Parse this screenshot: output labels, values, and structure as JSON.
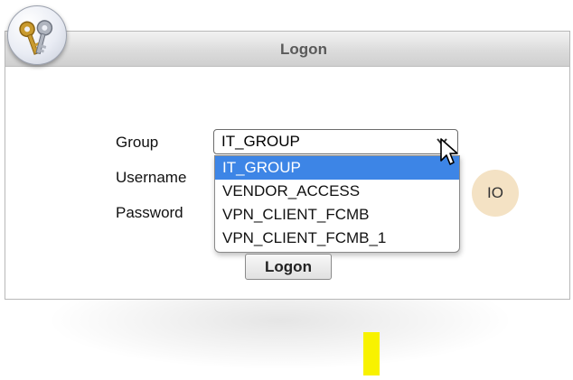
{
  "window": {
    "title": "Logon"
  },
  "form": {
    "group_label": "Group",
    "username_label": "Username",
    "password_label": "Password",
    "group_selected": "IT_GROUP",
    "group_options": [
      "IT_GROUP",
      "VENDOR_ACCESS",
      "VPN_CLIENT_FCMB",
      "VPN_CLIENT_FCMB_1"
    ],
    "submit_label": "Logon"
  },
  "badge": {
    "text": "IO"
  },
  "colors": {
    "selected_option": "#3d85e6",
    "io_badge": "#f4e2c4",
    "highlight_bar": "#f8f200"
  },
  "icons": [
    "keys-icon",
    "chevron-down-icon",
    "mouse-cursor-icon"
  ]
}
